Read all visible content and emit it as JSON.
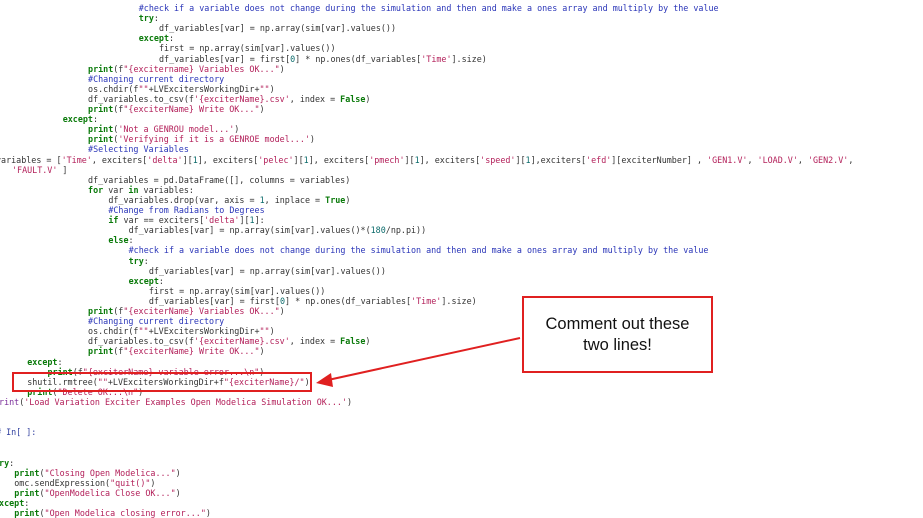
{
  "lines": [
    {
      "indent": 25,
      "segments": [
        {
          "c": "cm",
          "t": "#check if a variable does not change during the simulation and then and make a ones array and multiply by the value"
        }
      ]
    },
    {
      "indent": 25,
      "segments": [
        {
          "c": "kw",
          "t": "try"
        },
        {
          "c": "pl",
          "t": ":"
        }
      ]
    },
    {
      "indent": 29,
      "segments": [
        {
          "c": "pl",
          "t": "df_variables[var] = np.array(sim[var].values())"
        }
      ]
    },
    {
      "indent": 25,
      "segments": [
        {
          "c": "kw",
          "t": "except"
        },
        {
          "c": "pl",
          "t": ":"
        }
      ]
    },
    {
      "indent": 29,
      "segments": [
        {
          "c": "pl",
          "t": "first = np.array(sim[var].values())"
        }
      ]
    },
    {
      "indent": 29,
      "segments": [
        {
          "c": "pl",
          "t": "df_variables[var] = first["
        },
        {
          "c": "nm",
          "t": "0"
        },
        {
          "c": "pl",
          "t": "] * np.ones(df_variables["
        },
        {
          "c": "st",
          "t": "'Time'"
        },
        {
          "c": "pl",
          "t": "].size)"
        }
      ]
    },
    {
      "indent": 15,
      "segments": [
        {
          "c": "kw",
          "t": "print"
        },
        {
          "c": "pl",
          "t": "(f"
        },
        {
          "c": "st",
          "t": "\"{excitername} Variables OK...\""
        },
        {
          "c": "pl",
          "t": ")"
        }
      ]
    },
    {
      "indent": 15,
      "segments": [
        {
          "c": "cm",
          "t": "#Changing current directory"
        }
      ]
    },
    {
      "indent": 15,
      "segments": [
        {
          "c": "pl",
          "t": "os.chdir(f"
        },
        {
          "c": "st",
          "t": "\"\""
        },
        {
          "c": "pl",
          "t": "+LVExcitersWorkingDir+"
        },
        {
          "c": "st",
          "t": "\"\""
        },
        {
          "c": "pl",
          "t": ")"
        }
      ]
    },
    {
      "indent": 15,
      "segments": [
        {
          "c": "pl",
          "t": "df_variables.to_csv(f"
        },
        {
          "c": "st",
          "t": "'{exciterName}.csv'"
        },
        {
          "c": "pl",
          "t": ", index = "
        },
        {
          "c": "kw",
          "t": "False"
        },
        {
          "c": "pl",
          "t": ")"
        }
      ]
    },
    {
      "indent": 15,
      "segments": [
        {
          "c": "kw",
          "t": "print"
        },
        {
          "c": "pl",
          "t": "(f"
        },
        {
          "c": "st",
          "t": "\"{exciterName} Write OK...\""
        },
        {
          "c": "pl",
          "t": ")"
        }
      ]
    },
    {
      "indent": 10,
      "segments": [
        {
          "c": "kw",
          "t": "except"
        },
        {
          "c": "pl",
          "t": ":"
        }
      ]
    },
    {
      "indent": 15,
      "segments": [
        {
          "c": "kw",
          "t": "print"
        },
        {
          "c": "pl",
          "t": "("
        },
        {
          "c": "st",
          "t": "'Not a GENROU model...'"
        },
        {
          "c": "pl",
          "t": ")"
        }
      ]
    },
    {
      "indent": 15,
      "segments": [
        {
          "c": "kw",
          "t": "print"
        },
        {
          "c": "pl",
          "t": "("
        },
        {
          "c": "st",
          "t": "'Verifying if it is a GENROE model...'"
        },
        {
          "c": "pl",
          "t": ")"
        }
      ]
    },
    {
      "indent": 15,
      "segments": [
        {
          "c": "cm",
          "t": "#Selecting Variables"
        }
      ]
    },
    {
      "indent": 15,
      "segments": [
        {
          "c": "pl",
          "t": "variables = ["
        },
        {
          "c": "st",
          "t": "'Time'"
        },
        {
          "c": "pl",
          "t": ", exciters["
        },
        {
          "c": "st",
          "t": "'delta'"
        },
        {
          "c": "pl",
          "t": "]["
        },
        {
          "c": "nm",
          "t": "1"
        },
        {
          "c": "pl",
          "t": "], exciters["
        },
        {
          "c": "st",
          "t": "'pelec'"
        },
        {
          "c": "pl",
          "t": "]["
        },
        {
          "c": "nm",
          "t": "1"
        },
        {
          "c": "pl",
          "t": "], exciters["
        },
        {
          "c": "st",
          "t": "'pmech'"
        },
        {
          "c": "pl",
          "t": "]["
        },
        {
          "c": "nm",
          "t": "1"
        },
        {
          "c": "pl",
          "t": "], exciters["
        },
        {
          "c": "st",
          "t": "'speed'"
        },
        {
          "c": "pl",
          "t": "]["
        },
        {
          "c": "nm",
          "t": "1"
        },
        {
          "c": "pl",
          "t": "],exciters["
        },
        {
          "c": "st",
          "t": "'efd'"
        },
        {
          "c": "pl",
          "t": "][exciterNumber] , "
        },
        {
          "c": "st",
          "t": "'GEN1.V'"
        },
        {
          "c": "pl",
          "t": ", "
        },
        {
          "c": "st",
          "t": "'LOAD.V'"
        },
        {
          "c": "pl",
          "t": ", "
        },
        {
          "c": "st",
          "t": "'GEN2.V'"
        },
        {
          "c": "pl",
          "t": ","
        }
      ]
    },
    {
      "indent": 0,
      "segments": [
        {
          "c": "st",
          "t": "'FAULT.V'"
        },
        {
          "c": "pl",
          "t": " ]"
        }
      ]
    },
    {
      "indent": 15,
      "segments": [
        {
          "c": "pl",
          "t": "df_variables = pd.DataFrame([], columns = variables)"
        }
      ]
    },
    {
      "indent": 15,
      "segments": [
        {
          "c": "kw",
          "t": "for"
        },
        {
          "c": "pl",
          "t": " var "
        },
        {
          "c": "kw",
          "t": "in"
        },
        {
          "c": "pl",
          "t": " variables:"
        }
      ]
    },
    {
      "indent": 19,
      "segments": [
        {
          "c": "pl",
          "t": "df_variables.drop(var, axis = "
        },
        {
          "c": "nm",
          "t": "1"
        },
        {
          "c": "pl",
          "t": ", inplace = "
        },
        {
          "c": "kw",
          "t": "True"
        },
        {
          "c": "pl",
          "t": ")"
        }
      ]
    },
    {
      "indent": 19,
      "segments": [
        {
          "c": "cm",
          "t": "#Change from Radians to Degrees"
        }
      ]
    },
    {
      "indent": 19,
      "segments": [
        {
          "c": "kw",
          "t": "if"
        },
        {
          "c": "pl",
          "t": " var == exciters["
        },
        {
          "c": "st",
          "t": "'delta'"
        },
        {
          "c": "pl",
          "t": "]["
        },
        {
          "c": "nm",
          "t": "1"
        },
        {
          "c": "pl",
          "t": "]:"
        }
      ]
    },
    {
      "indent": 23,
      "segments": [
        {
          "c": "pl",
          "t": "df_variables[var] = np.array(sim[var].values()*("
        },
        {
          "c": "nm",
          "t": "180"
        },
        {
          "c": "pl",
          "t": "/np.pi))"
        }
      ]
    },
    {
      "indent": 19,
      "segments": [
        {
          "c": "kw",
          "t": "else"
        },
        {
          "c": "pl",
          "t": ":"
        }
      ]
    },
    {
      "indent": 23,
      "segments": [
        {
          "c": "cm",
          "t": "#check if a variable does not change during the simulation and then and make a ones array and multiply by the value"
        }
      ]
    },
    {
      "indent": 23,
      "segments": [
        {
          "c": "kw",
          "t": "try"
        },
        {
          "c": "pl",
          "t": ":"
        }
      ]
    },
    {
      "indent": 27,
      "segments": [
        {
          "c": "pl",
          "t": "df_variables[var] = np.array(sim[var].values())"
        }
      ]
    },
    {
      "indent": 23,
      "segments": [
        {
          "c": "kw",
          "t": "except"
        },
        {
          "c": "pl",
          "t": ":"
        }
      ]
    },
    {
      "indent": 27,
      "segments": [
        {
          "c": "pl",
          "t": "first = np.array(sim[var].values())"
        }
      ]
    },
    {
      "indent": 27,
      "segments": [
        {
          "c": "pl",
          "t": "df_variables[var] = first["
        },
        {
          "c": "nm",
          "t": "0"
        },
        {
          "c": "pl",
          "t": "] * np.ones(df_variables["
        },
        {
          "c": "st",
          "t": "'Time'"
        },
        {
          "c": "pl",
          "t": "].size)"
        }
      ]
    },
    {
      "indent": 15,
      "segments": [
        {
          "c": "kw",
          "t": "print"
        },
        {
          "c": "pl",
          "t": "(f"
        },
        {
          "c": "st",
          "t": "\"{exciterName} Variables OK...\""
        },
        {
          "c": "pl",
          "t": ")"
        }
      ]
    },
    {
      "indent": 15,
      "segments": [
        {
          "c": "cm",
          "t": "#Changing current directory"
        }
      ]
    },
    {
      "indent": 15,
      "segments": [
        {
          "c": "pl",
          "t": "os.chdir(f"
        },
        {
          "c": "st",
          "t": "\"\""
        },
        {
          "c": "pl",
          "t": "+LVExcitersWorkingDir+"
        },
        {
          "c": "st",
          "t": "\"\""
        },
        {
          "c": "pl",
          "t": ")"
        }
      ]
    },
    {
      "indent": 15,
      "segments": [
        {
          "c": "pl",
          "t": "df_variables.to_csv(f"
        },
        {
          "c": "st",
          "t": "'{exciterName}.csv'"
        },
        {
          "c": "pl",
          "t": ", index = "
        },
        {
          "c": "kw",
          "t": "False"
        },
        {
          "c": "pl",
          "t": ")"
        }
      ]
    },
    {
      "indent": 15,
      "segments": [
        {
          "c": "kw",
          "t": "print"
        },
        {
          "c": "pl",
          "t": "(f"
        },
        {
          "c": "st",
          "t": "\"{exciterName} Write OK...\""
        },
        {
          "c": "pl",
          "t": ")"
        }
      ]
    },
    {
      "indent": 3,
      "segments": [
        {
          "c": "kw",
          "t": "except"
        },
        {
          "c": "pl",
          "t": ":"
        }
      ]
    },
    {
      "indent": 7,
      "segments": [
        {
          "c": "kw",
          "t": "print"
        },
        {
          "c": "pl",
          "t": "(f"
        },
        {
          "c": "st",
          "t": "\"{exciterName} variable error...\\n\""
        },
        {
          "c": "pl",
          "t": ")"
        }
      ]
    },
    {
      "indent": 3,
      "segments": [
        {
          "c": "pl",
          "t": "shutil.rmtree("
        },
        {
          "c": "st",
          "t": "\"\""
        },
        {
          "c": "pl",
          "t": "+LVExcitersWorkingDir+f"
        },
        {
          "c": "st",
          "t": "\"{exciterName}/\""
        },
        {
          "c": "pl",
          "t": ")"
        }
      ]
    },
    {
      "indent": 3,
      "segments": [
        {
          "c": "kw",
          "t": "print"
        },
        {
          "c": "pl",
          "t": "("
        },
        {
          "c": "st",
          "t": "\"Delete OK...\\n\""
        },
        {
          "c": "pl",
          "t": ")"
        }
      ]
    },
    {
      "indent": 0,
      "segments": [
        {
          "c": "bi",
          "t": "print"
        },
        {
          "c": "pl",
          "t": "("
        },
        {
          "c": "st",
          "t": "'Load Variation Exciter Examples Open Modelica Simulation OK...'"
        },
        {
          "c": "pl",
          "t": ")"
        }
      ]
    },
    {
      "indent": 0,
      "segments": []
    },
    {
      "indent": 0,
      "segments": []
    },
    {
      "indent": 0,
      "segments": [
        {
          "c": "prompt",
          "t": "# In[ ]:"
        }
      ]
    },
    {
      "indent": 0,
      "segments": []
    },
    {
      "indent": 0,
      "segments": []
    },
    {
      "indent": 0,
      "segments": [
        {
          "c": "kw",
          "t": "try"
        },
        {
          "c": "pl",
          "t": ":"
        }
      ]
    },
    {
      "indent": 4,
      "segments": [
        {
          "c": "kw",
          "t": "print"
        },
        {
          "c": "pl",
          "t": "("
        },
        {
          "c": "st",
          "t": "\"Closing Open Modelica...\""
        },
        {
          "c": "pl",
          "t": ")"
        }
      ]
    },
    {
      "indent": 4,
      "segments": [
        {
          "c": "pl",
          "t": "omc.sendExpression("
        },
        {
          "c": "st",
          "t": "\"quit()\""
        },
        {
          "c": "pl",
          "t": ")"
        }
      ]
    },
    {
      "indent": 4,
      "segments": [
        {
          "c": "kw",
          "t": "print"
        },
        {
          "c": "pl",
          "t": "("
        },
        {
          "c": "st",
          "t": "\"OpenModelica Close OK...\""
        },
        {
          "c": "pl",
          "t": ")"
        }
      ]
    },
    {
      "indent": 0,
      "segments": [
        {
          "c": "kw",
          "t": "except"
        },
        {
          "c": "pl",
          "t": ":"
        }
      ]
    },
    {
      "indent": 4,
      "segments": [
        {
          "c": "kw",
          "t": "print"
        },
        {
          "c": "pl",
          "t": "("
        },
        {
          "c": "st",
          "t": "\"Open Modelica closing error...\""
        },
        {
          "c": "pl",
          "t": ")"
        }
      ]
    }
  ],
  "callout": {
    "text": "Comment out these two lines!",
    "border_color": "#e02020"
  },
  "highlight": {
    "color": "#e02020"
  },
  "colors": {
    "keyword": "#0a7a0a",
    "comment": "#2a35b8",
    "string": "#b3205a",
    "number": "#0c6b6b",
    "builtin": "#7a2e9a",
    "plain": "#333333"
  }
}
